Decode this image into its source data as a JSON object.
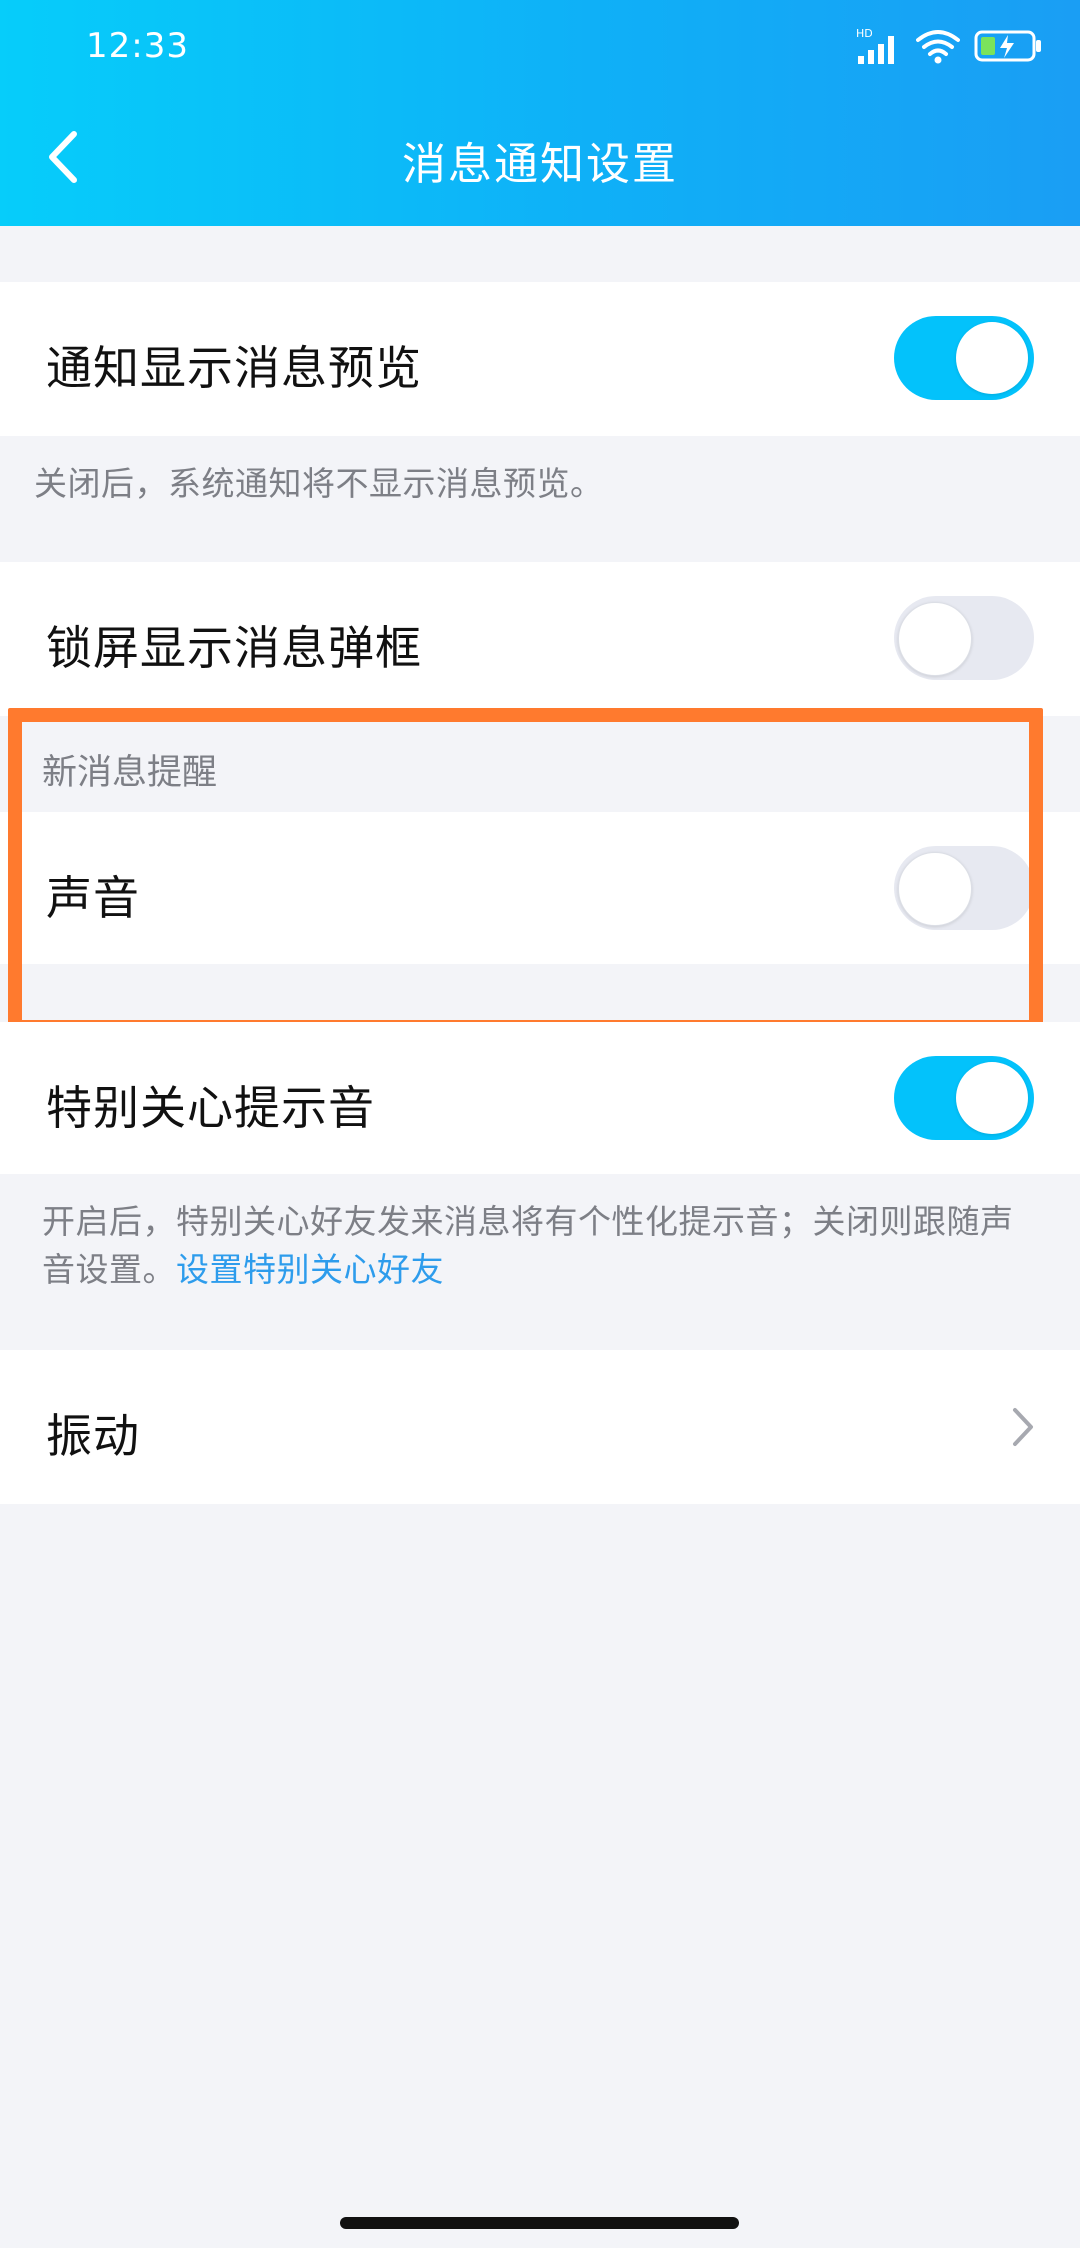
{
  "status_bar": {
    "time": "12:33",
    "network_label": "HD"
  },
  "header": {
    "title": "消息通知设置"
  },
  "settings": {
    "preview": {
      "label": "通知显示消息预览",
      "enabled": true
    },
    "preview_hint": "关闭后，系统通知将不显示消息预览。",
    "lockscreen": {
      "label": "锁屏显示消息弹框",
      "enabled": false
    },
    "new_message_section": "新消息提醒",
    "sound": {
      "label": "声音",
      "enabled": false
    },
    "special_care_sound": {
      "label": "特别关心提示音",
      "enabled": true
    },
    "special_care_hint": "开启后，特别关心好友发来消息将有个性化提示音；关闭则跟随声音设置。",
    "special_care_link": "设置特别关心好友",
    "vibration": {
      "label": "振动"
    }
  },
  "colors": {
    "header_gradient_start": "#06cdfa",
    "header_gradient_end": "#1a9ef4",
    "toggle_on": "#03c2fb",
    "highlight_border": "#ff7a2e",
    "link": "#2d9cec"
  }
}
